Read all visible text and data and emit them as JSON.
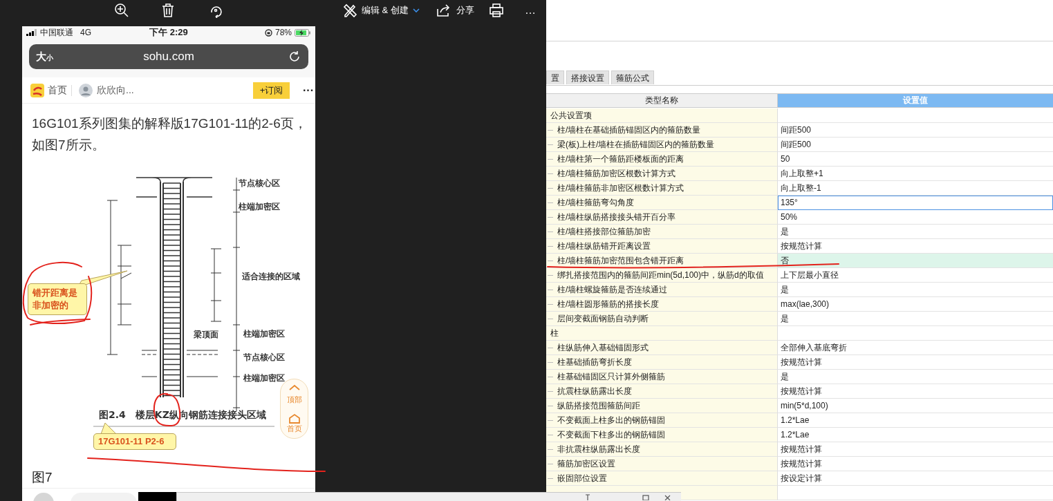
{
  "viewer_toolbar": {
    "edit_menu": "编辑 & 创建",
    "share": "分享",
    "more": "…"
  },
  "phone": {
    "status_bar": {
      "carrier": "中国联通",
      "network": "4G",
      "time": "下午 2:29",
      "battery": "78%"
    },
    "address_bar": {
      "text_size_big": "大",
      "text_size_small": "小",
      "url": "sohu.com"
    },
    "nav": {
      "home": "首页",
      "author": "欣欣向...",
      "subscribe": "+订阅",
      "more": "···"
    },
    "article": {
      "paragraph": "16G101系列图集的解释版17G101-11的2-6页，如图7所示。",
      "figure": {
        "labels": [
          "节点核心区",
          "柱端加密区",
          "适合连接的区域",
          "梁顶面",
          "柱端加密区",
          "节点核心区",
          "柱端加密区"
        ],
        "caption": "图2.4　楼层KZ纵向钢筋连接接头区域"
      },
      "figure_title": "图7"
    },
    "callouts": [
      {
        "text": "错开距离是非加密的"
      },
      {
        "text": "17G101-11 P2-6"
      }
    ],
    "float_buttons": [
      {
        "kind": "top",
        "label": "顶部"
      },
      {
        "kind": "home",
        "label": "首页"
      }
    ]
  },
  "settings": {
    "tabs": [
      {
        "label": "置",
        "selected": false
      },
      {
        "label": "搭接设置",
        "selected": false
      },
      {
        "label": "箍筋公式",
        "selected": false
      }
    ],
    "columns": [
      "类型名称",
      "设置值"
    ],
    "rows": [
      {
        "kind": "group",
        "name": "公共设置项",
        "selected": false,
        "focused": false
      },
      {
        "kind": "item",
        "name": "柱/墙柱在基础插筋锚固区内的箍筋数量",
        "value": "间距500",
        "selected": false,
        "focused": false
      },
      {
        "kind": "item",
        "name": "梁(板)上柱/墙柱在插筋锚固区内的箍筋数量",
        "value": "间距500",
        "selected": false,
        "focused": false
      },
      {
        "kind": "item",
        "name": "柱/墙柱第一个箍筋距楼板面的距离",
        "value": "50",
        "selected": false,
        "focused": false
      },
      {
        "kind": "item",
        "name": "柱/墙柱箍筋加密区根数计算方式",
        "value": "向上取整+1",
        "selected": false,
        "focused": false
      },
      {
        "kind": "item",
        "name": "柱/墙柱箍筋非加密区根数计算方式",
        "value": "向上取整-1",
        "selected": false,
        "focused": false
      },
      {
        "kind": "item",
        "name": "柱/墙柱箍筋弯勾角度",
        "value": "135°",
        "selected": false,
        "focused": true
      },
      {
        "kind": "item",
        "name": "柱/墙柱纵筋搭接接头错开百分率",
        "value": "50%",
        "selected": false,
        "focused": false
      },
      {
        "kind": "item",
        "name": "柱/墙柱搭接部位箍筋加密",
        "value": "是",
        "selected": false,
        "focused": false
      },
      {
        "kind": "item",
        "name": "柱/墙柱纵筋错开距离设置",
        "value": "按规范计算",
        "selected": false,
        "focused": false
      },
      {
        "kind": "item",
        "name": "柱/墙柱箍筋加密范围包含错开距离",
        "value": "否",
        "selected": true,
        "focused": false
      },
      {
        "kind": "item",
        "name": "绑扎搭接范围内的箍筋间距min(5d,100)中，纵筋d的取值",
        "value": "上下层最小直径",
        "selected": false,
        "focused": false
      },
      {
        "kind": "item",
        "name": "柱/墙柱螺旋箍筋是否连续通过",
        "value": "是",
        "selected": false,
        "focused": false
      },
      {
        "kind": "item",
        "name": "柱/墙柱圆形箍筋的搭接长度",
        "value": "max(lae,300)",
        "selected": false,
        "focused": false
      },
      {
        "kind": "item",
        "name": "层间变截面钢筋自动判断",
        "value": "是",
        "selected": false,
        "focused": false
      },
      {
        "kind": "group",
        "name": "柱",
        "selected": false,
        "focused": false
      },
      {
        "kind": "item",
        "name": "柱纵筋伸入基础锚固形式",
        "value": "全部伸入基底弯折",
        "selected": false,
        "focused": false
      },
      {
        "kind": "item",
        "name": "柱基础插筋弯折长度",
        "value": "按规范计算",
        "selected": false,
        "focused": false
      },
      {
        "kind": "item",
        "name": "柱基础锚固区只计算外侧箍筋",
        "value": "是",
        "selected": false,
        "focused": false
      },
      {
        "kind": "item",
        "name": "抗震柱纵筋露出长度",
        "value": "按规范计算",
        "selected": false,
        "focused": false
      },
      {
        "kind": "item",
        "name": "纵筋搭接范围箍筋间距",
        "value": "min(5*d,100)",
        "selected": false,
        "focused": false
      },
      {
        "kind": "item",
        "name": "不变截面上柱多出的钢筋锚固",
        "value": "1.2*Lae",
        "selected": false,
        "focused": false
      },
      {
        "kind": "item",
        "name": "不变截面下柱多出的钢筋锚固",
        "value": "1.2*Lae",
        "selected": false,
        "focused": false
      },
      {
        "kind": "item",
        "name": "非抗震柱纵筋露出长度",
        "value": "按规范计算",
        "selected": false,
        "focused": false
      },
      {
        "kind": "item",
        "name": "箍筋加密区设置",
        "value": "按规范计算",
        "selected": false,
        "focused": false
      },
      {
        "kind": "item",
        "name": "嵌固部位设置",
        "value": "按设定计算",
        "selected": false,
        "focused": false
      }
    ]
  }
}
